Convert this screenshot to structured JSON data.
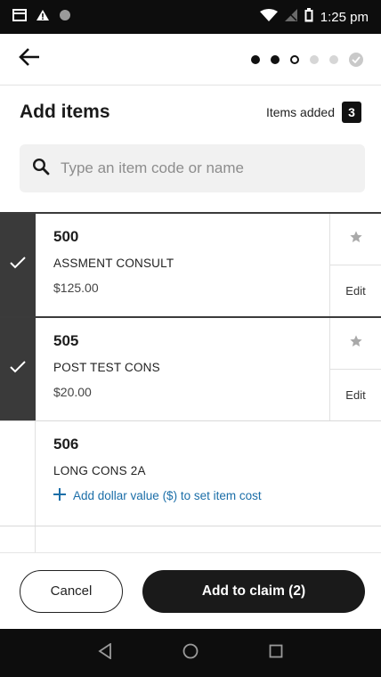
{
  "status_bar": {
    "time": "1:25 pm",
    "icons": [
      "notification-card-icon",
      "alert-icon",
      "circle-icon",
      "wifi-icon",
      "signal-icon",
      "battery-icon"
    ]
  },
  "app_bar": {
    "back_icon": "arrow-left-icon",
    "steps": [
      "done",
      "done",
      "current",
      "todo",
      "todo",
      "final-check"
    ]
  },
  "header": {
    "title": "Add items",
    "items_added_label": "Items added",
    "items_added_count": "3"
  },
  "search": {
    "placeholder": "Type an item code or name",
    "value": ""
  },
  "items": [
    {
      "code": "500",
      "name": "ASSMENT CONSULT",
      "price": "$125.00",
      "selected": true,
      "edit_label": "Edit"
    },
    {
      "code": "505",
      "name": "POST TEST CONS",
      "price": "$20.00",
      "selected": true,
      "edit_label": "Edit"
    },
    {
      "code": "506",
      "name": "LONG CONS 2A",
      "add_value_label": "Add dollar value ($) to set item cost",
      "selected": false
    }
  ],
  "footer": {
    "cancel_label": "Cancel",
    "primary_label": "Add to claim (2)"
  },
  "colors": {
    "selected_rail": "#3a3a3a",
    "primary_button": "#1a1a1a",
    "link_blue": "#1b6ea8",
    "search_bg": "#f1f1f1"
  }
}
